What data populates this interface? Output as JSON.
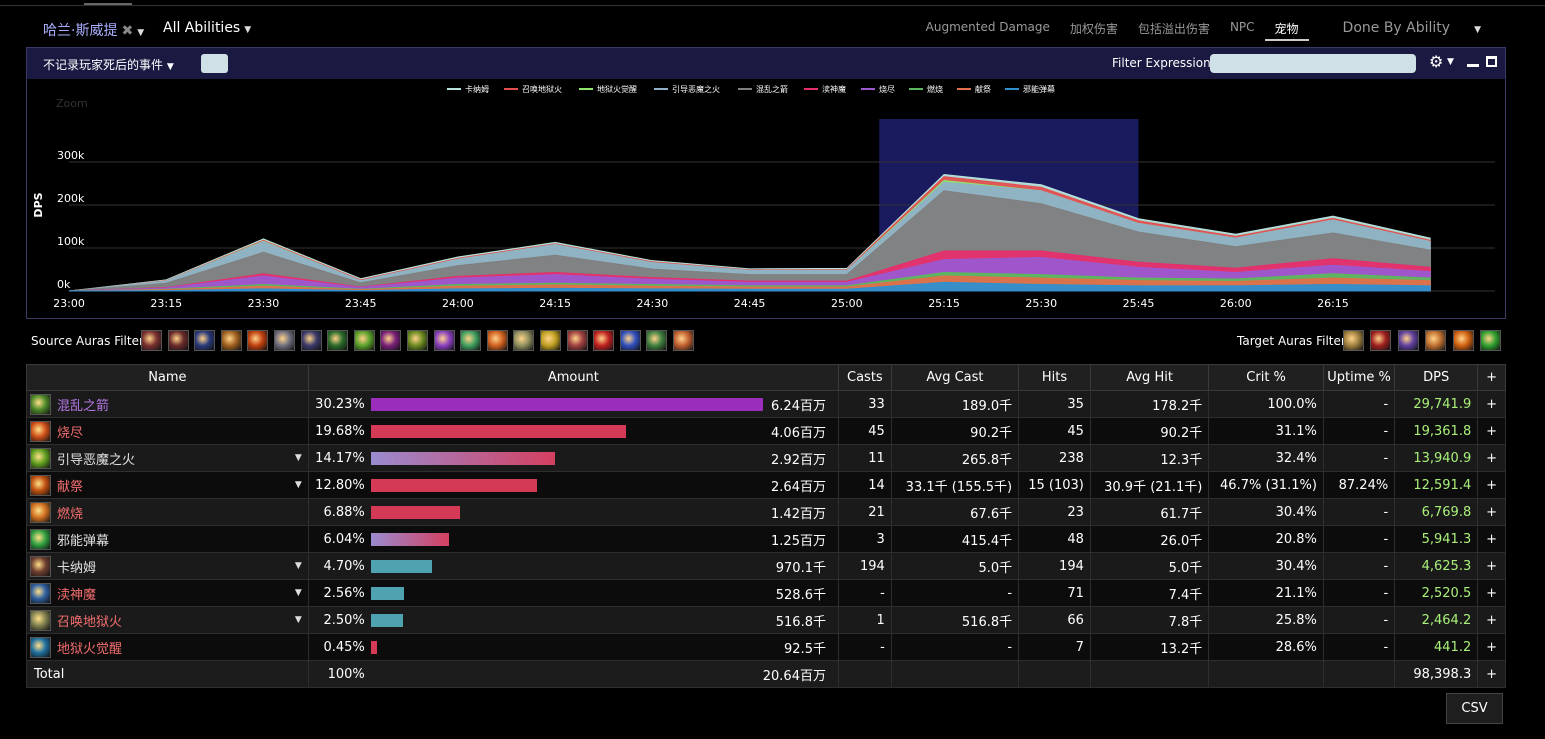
{
  "header": {
    "actor": "哈兰·斯威提",
    "abilities": "All Abilities",
    "views": [
      {
        "label": "Augmented Damage",
        "active": false
      },
      {
        "label": "加权伤害",
        "active": false
      },
      {
        "label": "包括溢出伤害",
        "active": false
      },
      {
        "label": "NPC",
        "active": false
      },
      {
        "label": "宠物",
        "active": true
      }
    ],
    "done_by": "Done By Ability"
  },
  "panel": {
    "no_death_label": "不记录玩家死后的事件",
    "filter_label": "Filter Expression:",
    "filter_value": ""
  },
  "chart_data": {
    "type": "area",
    "stacked": true,
    "ylabel": "DPS",
    "zoom_label": "Zoom",
    "y_ticks": [
      "0k",
      "100k",
      "200k",
      "300k"
    ],
    "ylim": [
      0,
      400000
    ],
    "x_ticks": [
      "23:00",
      "23:15",
      "23:30",
      "23:45",
      "24:00",
      "24:15",
      "24:30",
      "24:45",
      "25:00",
      "25:15",
      "25:30",
      "25:45",
      "26:00",
      "26:15"
    ],
    "x": [
      "23:00",
      "23:15",
      "23:30",
      "23:45",
      "24:00",
      "24:15",
      "24:30",
      "24:45",
      "25:00",
      "25:15",
      "25:30",
      "25:45",
      "26:00",
      "26:15",
      "26:30"
    ],
    "selection": [
      "25:05",
      "25:45"
    ],
    "series": [
      {
        "name": "卡纳姆",
        "color": "#b6e3dc",
        "values": [
          0,
          2000,
          3000,
          2500,
          3000,
          3000,
          2500,
          2000,
          2500,
          5000,
          6000,
          5000,
          5000,
          5000,
          5000
        ]
      },
      {
        "name": "召唤地狱火",
        "color": "#e25050",
        "values": [
          0,
          1000,
          2000,
          2000,
          2000,
          2000,
          2000,
          1500,
          2000,
          9000,
          8000,
          6000,
          4000,
          4000,
          3000
        ]
      },
      {
        "name": "地狱火觉醒",
        "color": "#8ee66a",
        "values": [
          0,
          0,
          1000,
          0,
          0,
          0,
          0,
          0,
          0,
          4000,
          0,
          0,
          0,
          0,
          0
        ]
      },
      {
        "name": "引导恶魔之火",
        "color": "#8fb0c8",
        "values": [
          0,
          5000,
          25000,
          5000,
          15000,
          25000,
          15000,
          10000,
          10000,
          20000,
          30000,
          20000,
          20000,
          30000,
          20000
        ]
      },
      {
        "name": "混乱之箭",
        "color": "#7f7f7f",
        "values": [
          0,
          10000,
          50000,
          10000,
          25000,
          40000,
          20000,
          15000,
          15000,
          140000,
          110000,
          70000,
          50000,
          60000,
          40000
        ]
      },
      {
        "name": "渎神魔",
        "color": "#e62e6b",
        "values": [
          0,
          1000,
          5000,
          1000,
          4000,
          5000,
          4000,
          3000,
          3000,
          20000,
          15000,
          12000,
          10000,
          15000,
          10000
        ]
      },
      {
        "name": "烧尽",
        "color": "#9b59d0",
        "values": [
          0,
          3000,
          20000,
          4000,
          15000,
          20000,
          12000,
          8000,
          8000,
          30000,
          40000,
          25000,
          15000,
          20000,
          15000
        ]
      },
      {
        "name": "燃烧",
        "color": "#5cb85c",
        "values": [
          0,
          1000,
          4000,
          1000,
          4000,
          4000,
          4000,
          3000,
          3000,
          8000,
          8000,
          6000,
          6000,
          10000,
          6000
        ]
      },
      {
        "name": "献祭",
        "color": "#e0704a",
        "values": [
          0,
          2000,
          6000,
          2000,
          6000,
          8000,
          6000,
          5000,
          5000,
          15000,
          15000,
          12000,
          10000,
          15000,
          12000
        ]
      },
      {
        "name": "邪能弹幕",
        "color": "#2f8fd0",
        "values": [
          0,
          1000,
          5000,
          1000,
          5000,
          6000,
          5000,
          4000,
          4000,
          20000,
          15000,
          12000,
          12000,
          15000,
          12000
        ]
      }
    ]
  },
  "source_auras_label": "Source Auras Filter:",
  "target_auras_label": "Target Auras Filter:",
  "source_auras": [
    {
      "icon": "aura-icon",
      "color": "#7a3030"
    },
    {
      "icon": "aura-icon",
      "color": "#6a2a2a"
    },
    {
      "icon": "aura-icon",
      "color": "#2a3a7a"
    },
    {
      "icon": "aura-icon",
      "color": "#a06020"
    },
    {
      "icon": "aura-icon",
      "color": "#c04010"
    },
    {
      "icon": "aura-icon",
      "color": "#707080"
    },
    {
      "icon": "aura-icon",
      "color": "#3a3a6a"
    },
    {
      "icon": "aura-icon",
      "color": "#2a6a2a"
    },
    {
      "icon": "aura-icon",
      "color": "#5aa02a"
    },
    {
      "icon": "aura-icon",
      "color": "#7a207a"
    },
    {
      "icon": "aura-icon",
      "color": "#6a8a20"
    },
    {
      "icon": "aura-icon",
      "color": "#8a40c0"
    },
    {
      "icon": "aura-icon",
      "color": "#40a060"
    },
    {
      "icon": "aura-icon",
      "color": "#d06020"
    },
    {
      "icon": "aura-icon",
      "color": "#909060"
    },
    {
      "icon": "aura-icon",
      "color": "#c0a020"
    },
    {
      "icon": "aura-icon",
      "color": "#a04040"
    },
    {
      "icon": "aura-icon",
      "color": "#c02020"
    },
    {
      "icon": "aura-icon",
      "color": "#3050c0"
    },
    {
      "icon": "aura-icon",
      "color": "#408040"
    },
    {
      "icon": "aura-icon",
      "color": "#c06030"
    }
  ],
  "target_auras": [
    {
      "icon": "aura-icon",
      "color": "#a08040"
    },
    {
      "icon": "aura-icon",
      "color": "#a02020"
    },
    {
      "icon": "aura-icon",
      "color": "#6040a0"
    },
    {
      "icon": "aura-icon",
      "color": "#c07030"
    },
    {
      "icon": "aura-icon",
      "color": "#d06010"
    },
    {
      "icon": "aura-icon",
      "color": "#30a030"
    }
  ],
  "table": {
    "headers": [
      "Name",
      "Amount",
      "Casts",
      "Avg Cast",
      "Hits",
      "Avg Hit",
      "Crit %",
      "Uptime %",
      "DPS",
      "+"
    ],
    "rows": [
      {
        "name": "混乱之箭",
        "name_color": "#b678e6",
        "icon_color": "#4f8a2a",
        "dropdown": false,
        "pct": "30.23%",
        "fraction": 1.0,
        "bar": "#9b2dbb",
        "amount": "6.24百万",
        "casts": "33",
        "avg_cast": "189.0千",
        "hits": "35",
        "avg_hit": "178.2千",
        "crit": "100.0%",
        "uptime": "-",
        "dps": "29,741.9"
      },
      {
        "name": "烧尽",
        "name_color": "#f26d6d",
        "icon_color": "#d0501a",
        "dropdown": false,
        "pct": "19.68%",
        "fraction": 0.651,
        "bar": "#d43a56",
        "amount": "4.06百万",
        "casts": "45",
        "avg_cast": "90.2千",
        "hits": "45",
        "avg_hit": "90.2千",
        "crit": "31.1%",
        "uptime": "-",
        "dps": "19,361.8"
      },
      {
        "name": "引导恶魔之火",
        "name_color": "#e0e0e0",
        "icon_color": "#60a020",
        "dropdown": true,
        "pct": "14.17%",
        "fraction": 0.469,
        "bar": "gradient",
        "amount": "2.92百万",
        "casts": "11",
        "avg_cast": "265.8千",
        "hits": "238",
        "avg_hit": "12.3千",
        "crit": "32.4%",
        "uptime": "-",
        "dps": "13,940.9"
      },
      {
        "name": "献祭",
        "name_color": "#f26d6d",
        "icon_color": "#c05010",
        "dropdown": true,
        "pct": "12.80%",
        "fraction": 0.423,
        "bar": "#d43a56",
        "amount": "2.64百万",
        "casts": "14",
        "avg_cast": "33.1千 (155.5千)",
        "hits": "15 (103)",
        "avg_hit": "30.9千 (21.1千)",
        "crit": "46.7% (31.1%)",
        "uptime": "87.24%",
        "dps": "12,591.4"
      },
      {
        "name": "燃烧",
        "name_color": "#f26d6d",
        "icon_color": "#d07020",
        "dropdown": false,
        "pct": "6.88%",
        "fraction": 0.228,
        "bar": "#d43a56",
        "amount": "1.42百万",
        "casts": "21",
        "avg_cast": "67.6千",
        "hits": "23",
        "avg_hit": "61.7千",
        "crit": "30.4%",
        "uptime": "-",
        "dps": "6,769.8"
      },
      {
        "name": "邪能弹幕",
        "name_color": "#e0e0e0",
        "icon_color": "#30a040",
        "dropdown": false,
        "pct": "6.04%",
        "fraction": 0.2,
        "bar": "gradient",
        "amount": "1.25百万",
        "casts": "3",
        "avg_cast": "415.4千",
        "hits": "48",
        "avg_hit": "26.0千",
        "crit": "20.8%",
        "uptime": "-",
        "dps": "5,941.3"
      },
      {
        "name": "卡纳姆",
        "name_color": "#e0e0e0",
        "icon_color": "#704030",
        "dropdown": true,
        "pct": "4.70%",
        "fraction": 0.155,
        "bar": "#4fa3b0",
        "amount": "970.1千",
        "casts": "194",
        "avg_cast": "5.0千",
        "hits": "194",
        "avg_hit": "5.0千",
        "crit": "30.4%",
        "uptime": "-",
        "dps": "4,625.3"
      },
      {
        "name": "渎神魔",
        "name_color": "#f26d6d",
        "icon_color": "#3060a0",
        "dropdown": true,
        "pct": "2.56%",
        "fraction": 0.085,
        "bar": "#4fa3b0",
        "amount": "528.6千",
        "casts": "-",
        "avg_cast": "-",
        "hits": "71",
        "avg_hit": "7.4千",
        "crit": "21.1%",
        "uptime": "-",
        "dps": "2,520.5"
      },
      {
        "name": "召唤地狱火",
        "name_color": "#f26d6d",
        "icon_color": "#808050",
        "dropdown": true,
        "pct": "2.50%",
        "fraction": 0.083,
        "bar": "#4fa3b0",
        "amount": "516.8千",
        "casts": "1",
        "avg_cast": "516.8千",
        "hits": "66",
        "avg_hit": "7.8千",
        "crit": "25.8%",
        "uptime": "-",
        "dps": "2,464.2"
      },
      {
        "name": "地狱火觉醒",
        "name_color": "#f26d6d",
        "icon_color": "#2070a0",
        "dropdown": false,
        "pct": "0.45%",
        "fraction": 0.015,
        "bar": "#d43a56",
        "amount": "92.5千",
        "casts": "-",
        "avg_cast": "-",
        "hits": "7",
        "avg_hit": "13.2千",
        "crit": "28.6%",
        "uptime": "-",
        "dps": "441.2"
      }
    ],
    "total": {
      "label": "Total",
      "pct": "100%",
      "amount": "20.64百万",
      "dps": "98,398.3"
    }
  },
  "csv_label": "CSV"
}
